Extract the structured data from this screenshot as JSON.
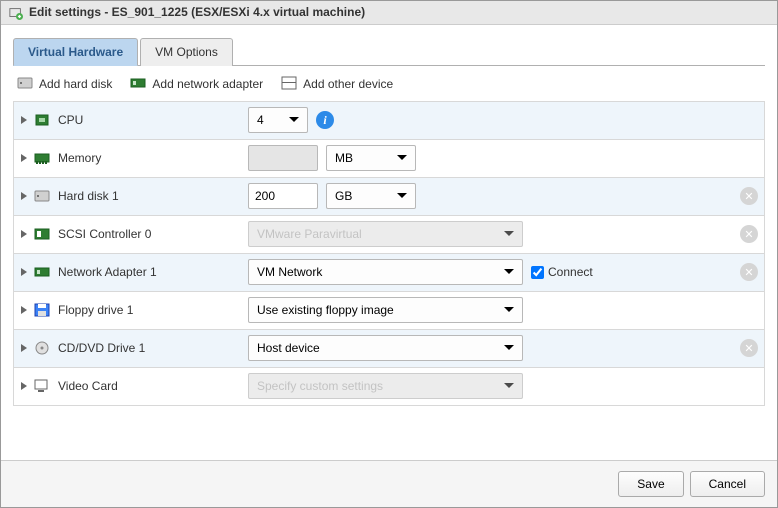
{
  "title": "Edit settings - ES_901_1225 (ESX/ESXi 4.x virtual machine)",
  "tabs": {
    "hardware": "Virtual Hardware",
    "options": "VM Options"
  },
  "toolbar": {
    "add_disk": "Add hard disk",
    "add_nic": "Add network adapter",
    "add_other": "Add other device"
  },
  "devices": {
    "cpu": {
      "label": "CPU",
      "value": "4"
    },
    "memory": {
      "label": "Memory",
      "value": "",
      "unit": "MB"
    },
    "disk": {
      "label": "Hard disk 1",
      "value": "200",
      "unit": "GB"
    },
    "scsi": {
      "label": "SCSI Controller 0",
      "value": "VMware Paravirtual"
    },
    "nic": {
      "label": "Network Adapter 1",
      "value": "VM Network",
      "connect": "Connect"
    },
    "floppy": {
      "label": "Floppy drive 1",
      "value": "Use existing floppy image"
    },
    "cd": {
      "label": "CD/DVD Drive 1",
      "value": "Host device"
    },
    "video": {
      "label": "Video Card",
      "value": "Specify custom settings"
    }
  },
  "buttons": {
    "save": "Save",
    "cancel": "Cancel"
  }
}
